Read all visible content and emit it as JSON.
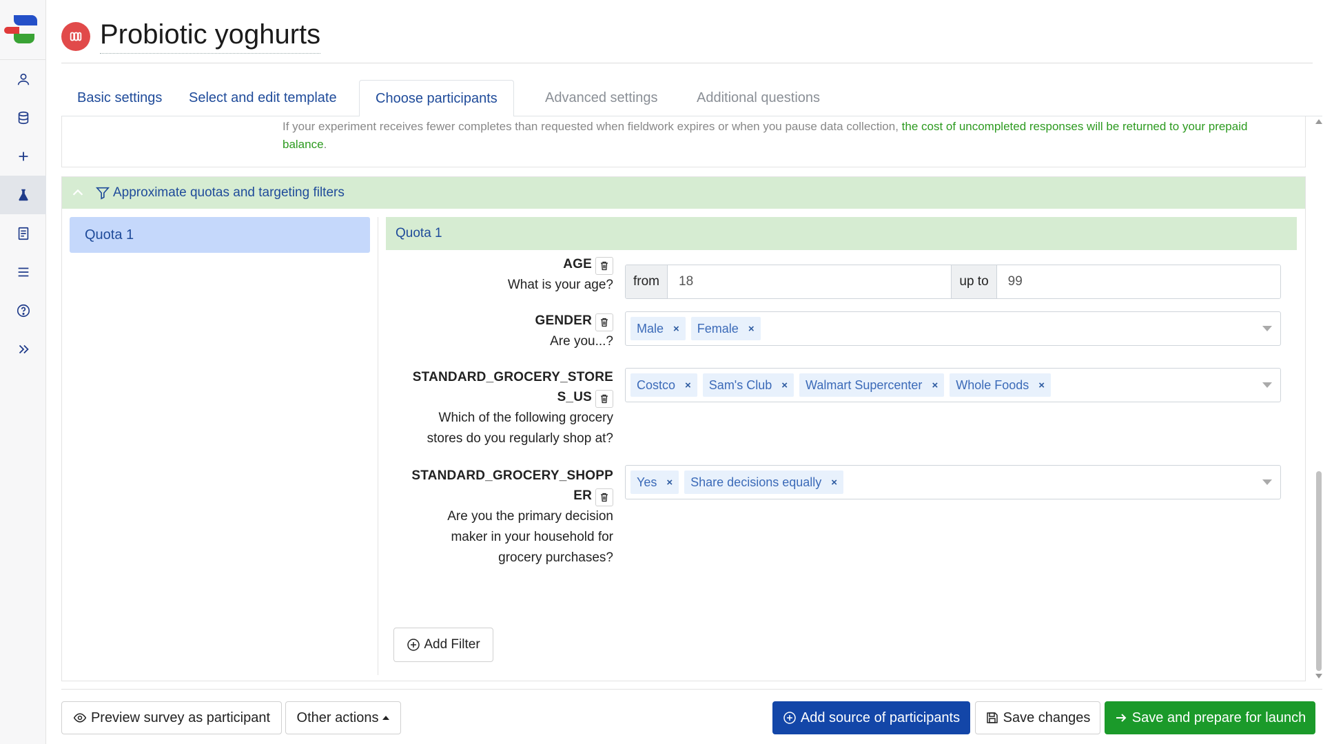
{
  "page": {
    "title": "Probiotic yoghurts"
  },
  "sidebar": {
    "icons": [
      "user-icon",
      "database-icon",
      "plus-icon",
      "flask-icon",
      "book-icon",
      "menu-icon",
      "help-icon",
      "double-chevron-right-icon"
    ],
    "active": "flask-icon"
  },
  "tabs": [
    {
      "label": "Basic settings",
      "state": "normal"
    },
    {
      "label": "Select and edit template",
      "state": "normal"
    },
    {
      "label": "Choose participants",
      "state": "active"
    },
    {
      "label": "Advanced settings",
      "state": "muted"
    },
    {
      "label": "Additional questions",
      "state": "muted"
    }
  ],
  "info": {
    "text": "If your experiment receives fewer completes than requested when fieldwork expires or when you pause data collection, ",
    "highlight": "the cost of uncompleted responses will be returned to your prepaid balance",
    "end": "."
  },
  "quotas": {
    "header": "Approximate quotas and targeting filters",
    "list": [
      "Quota 1"
    ],
    "selected_title": "Quota 1",
    "filters": {
      "age": {
        "name": "AGE",
        "question": "What is your age?",
        "from_label": "from",
        "from_value": "18",
        "to_label": "up to",
        "to_value": "99"
      },
      "gender": {
        "name": "GENDER",
        "question": "Are you...?",
        "chips": [
          "Male",
          "Female"
        ]
      },
      "stores": {
        "name_line1": "STANDARD_GROCERY_STORE",
        "name_line2": "S_US",
        "question_line1": "Which of the following grocery",
        "question_line2": "stores do you regularly shop at?",
        "chips": [
          "Costco",
          "Sam's Club",
          "Walmart Supercenter",
          "Whole Foods"
        ]
      },
      "shopper": {
        "name_line1": "STANDARD_GROCERY_SHOPP",
        "name_line2": "ER",
        "question_line1": "Are you the primary decision",
        "question_line2": "maker in your household for",
        "question_line3": "grocery purchases?",
        "chips": [
          "Yes",
          "Share decisions equally"
        ]
      }
    },
    "add_filter": "Add Filter",
    "chip_remove": "×"
  },
  "footer": {
    "preview": "Preview survey as participant",
    "other_actions": "Other actions",
    "add_source": "Add source of participants",
    "save": "Save changes",
    "save_launch": "Save and prepare for launch"
  },
  "colors": {
    "primary_blue": "#1346a8",
    "green": "#1b9a2a",
    "header_green": "#d6ecd2",
    "selected_quota": "#c5d8fb",
    "badge_red": "#e14a4a"
  }
}
